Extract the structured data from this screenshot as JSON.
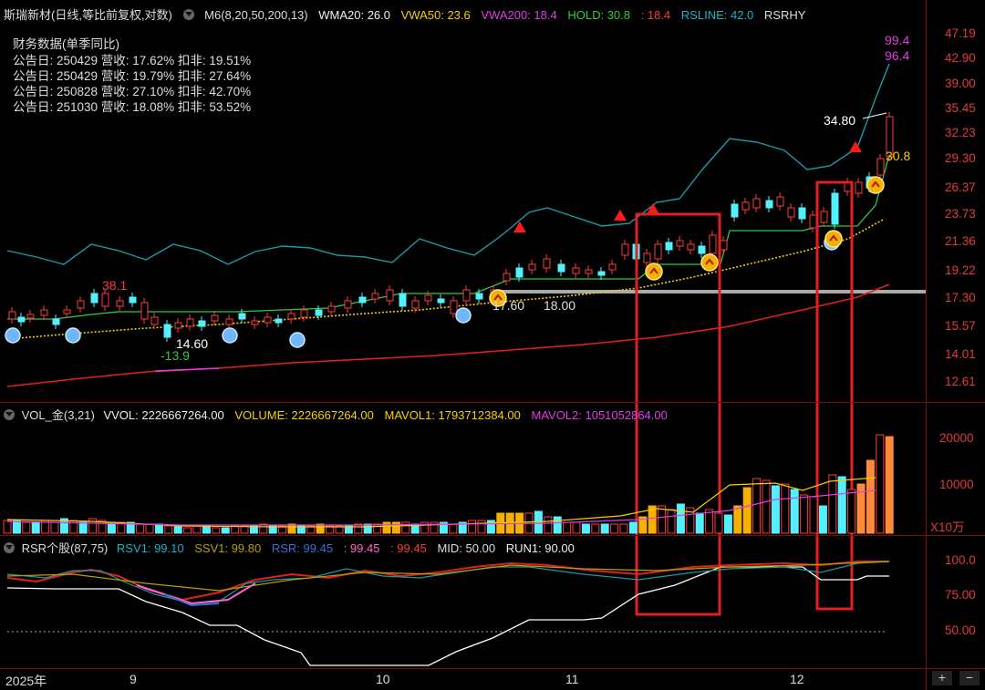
{
  "header": {
    "title": "斯瑞新材(日线,等比前复权,对数)",
    "m6": "M6(8,20,50,200,13)",
    "wma20": "WMA20: 26.0",
    "vwa50": "VWA50: 23.6",
    "vwa200": "VWA200: 18.4",
    "hold": "HOLD: 30.8",
    "hold2": ": 18.4",
    "rsline": "RSLINE: 42.0",
    "rsrhy": "RSRHY"
  },
  "financials": {
    "title": "财务数据(单季同比)",
    "rows": [
      "公告日: 250429  营收: 17.62%  扣非: 19.51%",
      "公告日: 250429  营收: 19.79%  扣非: 27.64%",
      "公告日: 250828  营收: 27.10%  扣非: 42.70%",
      "公告日: 251030  营收: 18.08%  扣非: 53.52%"
    ]
  },
  "price_axis": [
    "47.19",
    "42.90",
    "39.00",
    "35.45",
    "32.23",
    "29.30",
    "26.37",
    "23.73",
    "21.36",
    "19.22",
    "17.30",
    "15.57",
    "14.01",
    "12.61"
  ],
  "price_labels": {
    "rs_top1": "99.4",
    "rs_top2": "96.4",
    "hold_label": "30.8",
    "high": "34.80",
    "l1": "38.1",
    "l2": "14.60",
    "l3": "-13.9",
    "l4": "17.60",
    "l5": "18.00"
  },
  "volume": {
    "header": {
      "name": "VOL_金(3,21)",
      "vvol": "VVOL: 2226667264.00",
      "volume": "VOLUME: 2226667264.00",
      "mavol1": "MAVOL1: 1793712384.00",
      "mavol2": "MAVOL2: 1051052864.00"
    },
    "axis": [
      "20000",
      "10000"
    ],
    "unit": "X10万"
  },
  "rsr": {
    "header": {
      "name": "RSR个股(87,75)",
      "rsv1": "RSV1: 99.10",
      "ssv1": "SSV1: 99.80",
      "rsr": "RSR: 99.45",
      "v1": ": 99.45",
      "v2": ": 99.45",
      "mid": "MID: 50.00",
      "run1": "RUN1: 90.00"
    },
    "axis": [
      "100.0",
      "75.00",
      "50.00"
    ]
  },
  "date_axis": [
    "2025年",
    "9",
    "10",
    "11",
    "12"
  ],
  "controls": {
    "plus": "+",
    "minus": "−"
  },
  "colors": {
    "up": "#ff3a3a",
    "down": "#55f0ff",
    "accent_yellow": "#f5d000",
    "magenta": "#e23be8",
    "green": "#2ecc40",
    "teal": "#1b9aa8"
  }
}
